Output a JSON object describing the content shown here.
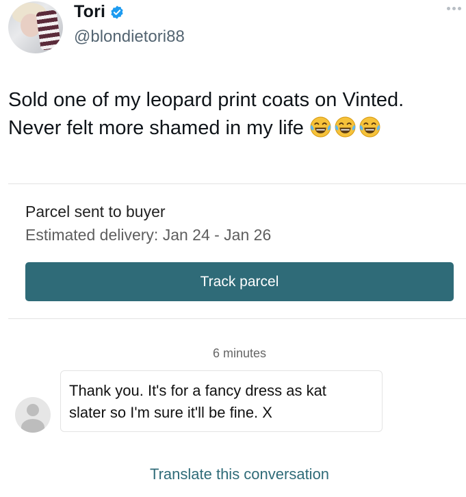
{
  "tweet": {
    "author": {
      "display_name": "Tori",
      "handle": "@blondietori88",
      "verified": true
    },
    "text": {
      "line1": "Sold one of my leopard print coats on Vinted.",
      "line2": "Never felt more shamed in my life"
    },
    "emojis": [
      "face-with-tears-of-joy-icon",
      "face-with-tears-of-joy-icon",
      "face-with-tears-of-joy-icon"
    ]
  },
  "parcel": {
    "status": "Parcel sent to buyer",
    "estimated_delivery": "Estimated delivery: Jan 24 - Jan 26",
    "track_button_label": "Track parcel"
  },
  "conversation": {
    "timestamp": "6 minutes",
    "message": {
      "line1": "Thank you. It's for a fancy dress as kat",
      "line2": "slater so I'm sure it'll be fine. X"
    },
    "translate_label": "Translate this conversation"
  },
  "colors": {
    "accent": "#2f6b78",
    "verified": "#1d9bf0",
    "emoji": "#f6c23a"
  }
}
